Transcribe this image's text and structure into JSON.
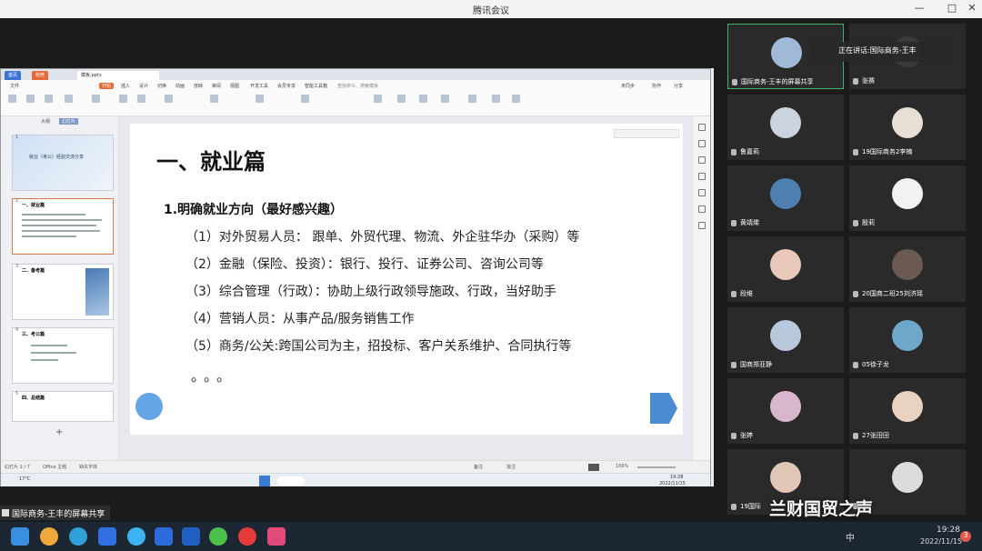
{
  "window": {
    "title": "腾讯会议",
    "controls": [
      "—",
      "□",
      "✕"
    ],
    "time": "2022/11/15"
  },
  "ppt": {
    "tabs": [
      "首页",
      "稻壳",
      "模板.pptx"
    ],
    "menu": [
      "文件",
      "开始",
      "插入",
      "设计",
      "切换",
      "动画",
      "放映",
      "审阅",
      "视图",
      "开发工具",
      "会员专享",
      "智能工具箱",
      "查找命令、搜索模板"
    ],
    "menu_right": [
      "未同步",
      "协作",
      "分享"
    ],
    "side_tabs": [
      "大纲",
      "幻灯片"
    ],
    "thumbs": [
      {
        "num": "1",
        "title": "就业（考公）经验交流分享"
      },
      {
        "num": "2",
        "title": "一、就业篇"
      },
      {
        "num": "3",
        "title": "二、备考篇"
      },
      {
        "num": "4",
        "title": "三、考公篇"
      },
      {
        "num": "5",
        "title": "四、总结篇"
      }
    ],
    "status": {
      "slide": "幻灯片 2 / 7",
      "theme": "Office 主题",
      "recover": "缺失字体",
      "zoom": "106%",
      "notes": "备注",
      "comment": "批注"
    },
    "tray": {
      "date": "2022/11/15",
      "time": "19:28",
      "temp": "17°C"
    }
  },
  "slide": {
    "title": "一、就业篇",
    "subtitle": "1.明确就业方向（最好感兴趣）",
    "items": [
      "（1）对外贸易人员： 跟单、外贸代理、物流、外企驻华办（采购）等",
      "（2）金融（保险、投资）：银行、投行、证券公司、咨询公司等",
      "（3）综合管理（行政）：协助上级行政领导施政、行政，当好助手",
      "（4）营销人员：从事产品/服务销售工作",
      "（5）商务/公关:跨国公司为主，招投标、客户关系维护、合同执行等"
    ],
    "ellipsis": "。。。"
  },
  "speaking": {
    "label": "正在讲话:",
    "names": "国际商务-王丰"
  },
  "participants": [
    {
      "name": "国际商务-王丰的屏幕共享",
      "color": "#9fb9d6"
    },
    {
      "name": "张赛",
      "color": "#3a3a3a"
    },
    {
      "name": "鲁嘉莉",
      "color": "#cbd3de"
    },
    {
      "name": "19国际商务2李楠",
      "color": "#e6dfd6"
    },
    {
      "name": "黄靖烯",
      "color": "#4d7fb0"
    },
    {
      "name": "殷莉",
      "color": "#f2f2f2"
    },
    {
      "name": "段维",
      "color": "#e8c9b9"
    },
    {
      "name": "20国商二班25刘济瑶",
      "color": "#6b5a52"
    },
    {
      "name": "国商郑亚静",
      "color": "#b7c8dc"
    },
    {
      "name": "05徐子龙",
      "color": "#6ea7c9"
    },
    {
      "name": "张婷",
      "color": "#d8b7cc"
    },
    {
      "name": "27张田田",
      "color": "#e9d3c0"
    },
    {
      "name": "19国际",
      "color": "#e0c6b5"
    },
    {
      "name": "",
      "color": "#dcdcdc"
    }
  ],
  "banner": "国际商务-王丰的屏幕共享",
  "watermark": "兰财国贸之声",
  "taskbar": {
    "lang": "中",
    "time": "19:28",
    "date": "2022/11/15",
    "badge": "3"
  }
}
